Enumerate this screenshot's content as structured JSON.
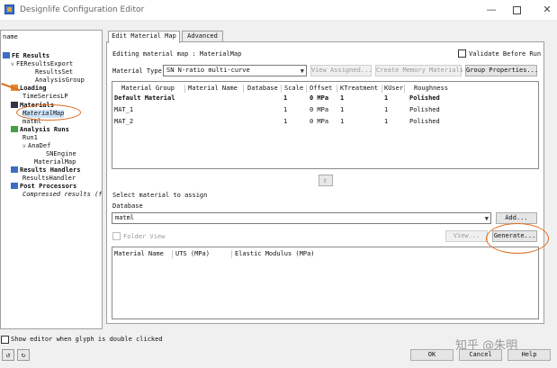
{
  "window": {
    "title": "Designlife Configuration Editor",
    "minimize": "—",
    "close": "✕"
  },
  "tree": {
    "root_label": "name",
    "fe_results": "FE Results",
    "fe_results_export": "FEResultsExport",
    "results_set": "ResultsSet",
    "analysis_group": "AnalysisGroup",
    "loading": "Loading",
    "time_series_lp": "TimeSeriesLP",
    "materials": "Materials",
    "material_map": "MaterialMap",
    "matml": "matml",
    "analysis_runs": "Analysis Runs",
    "run1": "Run1",
    "ana_def": "AnaDef",
    "sn_engine": "SNEngine",
    "material_map2": "MaterialMap",
    "results_handlers": "Results Handlers",
    "results_handler": "ResultsHandler",
    "post_processors": "Post Processors",
    "compressed_results": "Compressed results (fe"
  },
  "tabs": {
    "edit_material_map": "Edit Material Map",
    "advanced": "Advanced"
  },
  "editor": {
    "editing_label": "Editing material map : MaterialMap",
    "validate_before_run": "Validate Before Run",
    "material_type_label": "Material Type",
    "material_type_value": "SN N-ratio multi-curve",
    "view_assigned": "View Assigned...",
    "create_memory_materials": "Create Memory Materials",
    "group_properties": "Group Properties..."
  },
  "map_table": {
    "headers": [
      "Material Group",
      "Material Name",
      "Database",
      "Scale",
      "Offset",
      "KTreatment",
      "KUser",
      "Roughness"
    ],
    "rows": [
      [
        "Default Material",
        "",
        "",
        "1",
        "0 MPa",
        "1",
        "1",
        "Polished"
      ],
      [
        "MAT_1",
        "",
        "",
        "1",
        "0 MPa",
        "1",
        "1",
        "Polished"
      ],
      [
        "MAT_2",
        "",
        "",
        "1",
        "0 MPa",
        "1",
        "1",
        "Polished"
      ]
    ]
  },
  "assign": {
    "select_material_label": "Select material to assign",
    "database_label": "Database",
    "database_value": "matml",
    "add_button": "Add...",
    "folder_view": "Folder View",
    "view_button": "View...",
    "generate_button": "Generate..."
  },
  "material_table": {
    "headers": [
      "Material Name",
      "UTS (MPa)",
      "Elastic Modulus (MPa)"
    ]
  },
  "footer": {
    "show_editor": "Show editor when glyph is double clicked",
    "ok": "OK",
    "cancel": "Cancel",
    "help": "Help",
    "watermark": "知乎 @朱明"
  },
  "colors": {
    "annotation": "#e26a1f",
    "selection": "#cde3f7"
  }
}
